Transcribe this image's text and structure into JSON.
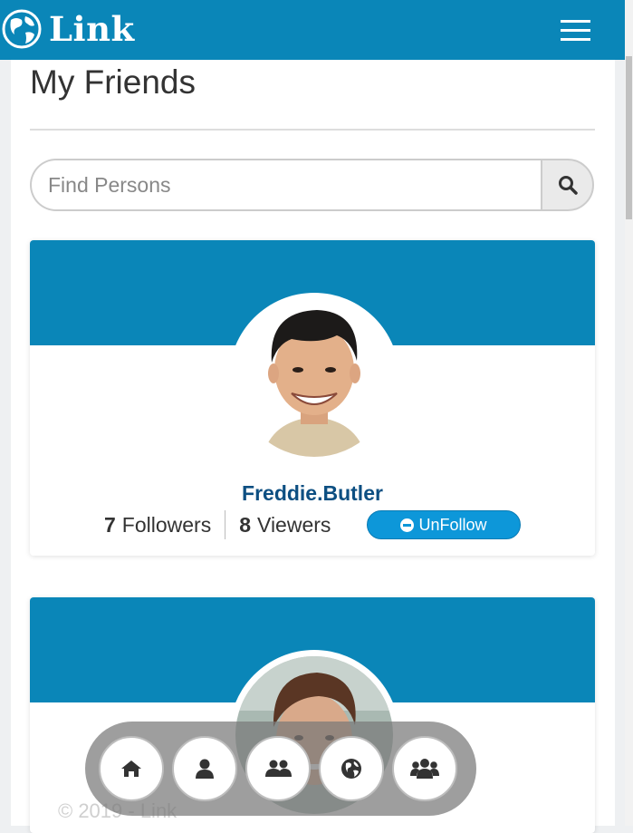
{
  "app": {
    "brand": "Link"
  },
  "page": {
    "title": "My Friends"
  },
  "search": {
    "placeholder": "Find Persons"
  },
  "friends": [
    {
      "username": "Freddie.Butler",
      "followers_count": "7",
      "followers_label": "Followers",
      "viewers_count": "8",
      "viewers_label": "Viewers",
      "action_label": "UnFollow"
    },
    {
      "username": "",
      "followers_count": "",
      "followers_label": "",
      "viewers_count": "",
      "viewers_label": "",
      "action_label": ""
    }
  ],
  "bottom_nav": [
    {
      "icon": "home-icon"
    },
    {
      "icon": "user-icon"
    },
    {
      "icon": "friends-icon"
    },
    {
      "icon": "globe-icon"
    },
    {
      "icon": "group-icon"
    }
  ],
  "footer": {
    "text": "© 2019 - Link"
  },
  "colors": {
    "brand": "#0a86b8",
    "username": "#0d4f82",
    "unfollow_button": "#0d97d9"
  }
}
